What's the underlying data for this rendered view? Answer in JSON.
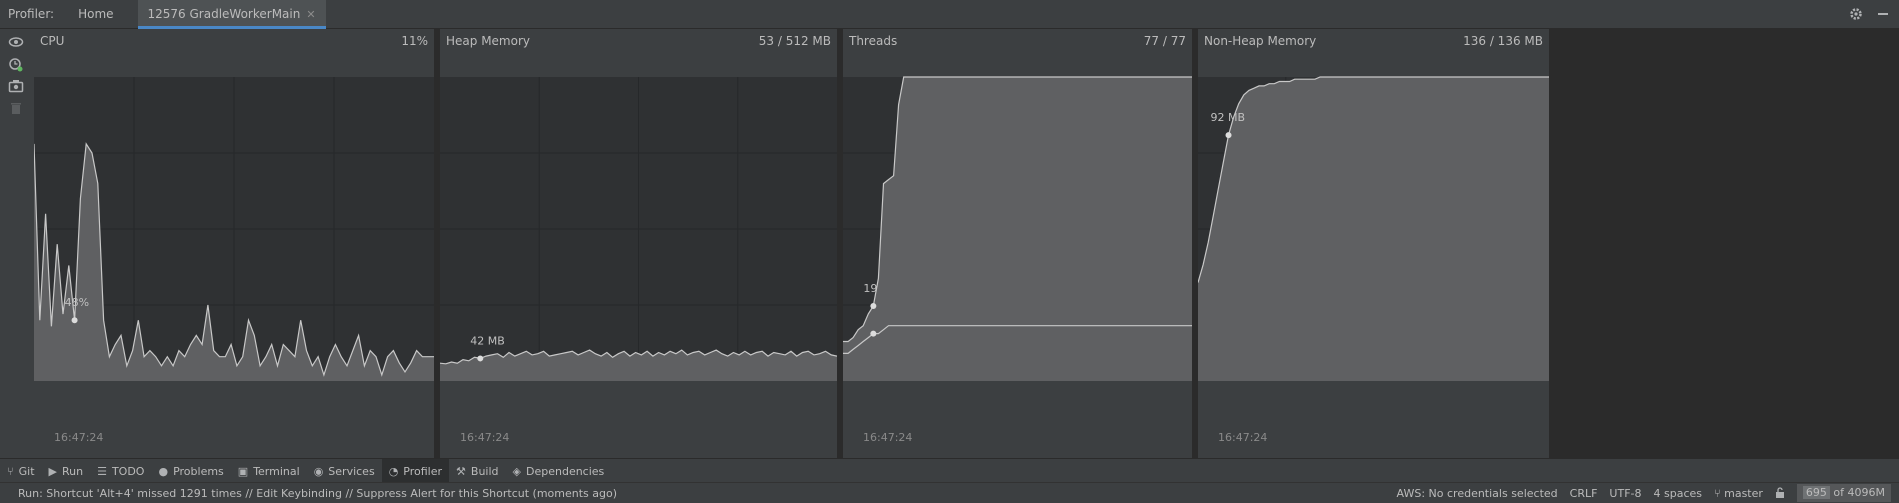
{
  "window": {
    "title": "Profiler:",
    "tabs": [
      {
        "label": "Home"
      },
      {
        "label": "12576 GradleWorkerMain"
      }
    ]
  },
  "panels": [
    {
      "title": "CPU",
      "value": "11%",
      "marker_label": "48%",
      "time": "16:47:24"
    },
    {
      "title": "Heap Memory",
      "value": "53 / 512 MB",
      "marker_label": "42 MB",
      "time": "16:47:24"
    },
    {
      "title": "Threads",
      "value": "77 / 77",
      "marker_label": "19",
      "time": "16:47:24"
    },
    {
      "title": "Non-Heap Memory",
      "value": "136 / 136 MB",
      "marker_label": "92 MB",
      "time": "16:47:24"
    }
  ],
  "bottom_tabs": [
    {
      "label": "Git",
      "icon": "git-branch-icon"
    },
    {
      "label": "Run",
      "icon": "run-icon"
    },
    {
      "label": "TODO",
      "icon": "todo-list-icon"
    },
    {
      "label": "Problems",
      "icon": "problems-icon"
    },
    {
      "label": "Terminal",
      "icon": "terminal-icon"
    },
    {
      "label": "Services",
      "icon": "services-icon"
    },
    {
      "label": "Profiler",
      "icon": "profiler-icon"
    },
    {
      "label": "Build",
      "icon": "build-hammer-icon"
    },
    {
      "label": "Dependencies",
      "icon": "dependencies-icon"
    }
  ],
  "status": {
    "message": "Run: Shortcut 'Alt+4' missed 1291 times // Edit Keybinding // Suppress Alert for this Shortcut (moments ago)",
    "aws": "AWS: No credentials selected",
    "line_sep": "CRLF",
    "encoding": "UTF-8",
    "indent": "4 spaces",
    "branch": "master",
    "memory_used": "695",
    "memory_total": "of 4096M"
  },
  "colors": {
    "accent": "#4a88c7",
    "chart_fill": "#5f6062",
    "chart_line": "#c8c8c8",
    "grid": "#2f3133"
  },
  "chart_data": [
    {
      "type": "area",
      "title": "CPU",
      "ylim": [
        0,
        100
      ],
      "y": [
        78,
        20,
        55,
        18,
        45,
        22,
        38,
        20,
        60,
        78,
        75,
        65,
        20,
        8,
        12,
        15,
        5,
        10,
        20,
        8,
        10,
        8,
        5,
        8,
        5,
        10,
        8,
        12,
        15,
        12,
        25,
        10,
        8,
        8,
        12,
        5,
        8,
        20,
        15,
        5,
        8,
        12,
        5,
        12,
        10,
        8,
        20,
        10,
        5,
        8,
        2,
        8,
        12,
        8,
        5,
        10,
        15,
        5,
        10,
        8,
        2,
        8,
        10,
        6,
        3,
        6,
        10,
        8,
        8,
        8
      ]
    },
    {
      "type": "area",
      "title": "Heap Memory",
      "ylim": [
        0,
        512
      ],
      "y": [
        30,
        29,
        32,
        30,
        36,
        34,
        40,
        38,
        42,
        44,
        46,
        40,
        48,
        42,
        46,
        50,
        44,
        46,
        50,
        42,
        44,
        46,
        48,
        50,
        44,
        48,
        52,
        46,
        42,
        48,
        40,
        46,
        50,
        42,
        48,
        44,
        50,
        42,
        48,
        44,
        50,
        46,
        52,
        44,
        48,
        50,
        44,
        48,
        52,
        46,
        42,
        48,
        44,
        50,
        44,
        48,
        50,
        42,
        48,
        46,
        44,
        50,
        42,
        48,
        50,
        44,
        46,
        50,
        44,
        42
      ]
    },
    {
      "type": "area",
      "title": "Threads",
      "ylim": [
        0,
        77
      ],
      "series": [
        {
          "values": [
            10,
            10,
            11,
            13,
            14,
            17,
            19,
            26,
            50,
            51,
            52,
            70,
            77,
            77,
            77,
            77,
            77,
            77,
            77,
            77,
            77,
            77,
            77,
            77,
            77,
            77,
            77,
            77,
            77,
            77,
            77,
            77,
            77,
            77,
            77,
            77,
            77,
            77,
            77,
            77,
            77,
            77,
            77,
            77,
            77,
            77,
            77,
            77,
            77,
            77,
            77,
            77,
            77,
            77,
            77,
            77,
            77,
            77,
            77,
            77,
            77,
            77,
            77,
            77,
            77,
            77,
            77,
            77,
            77,
            77
          ]
        },
        {
          "values": [
            7,
            7,
            8,
            9,
            10,
            11,
            12,
            12,
            13,
            14,
            14,
            14,
            14,
            14,
            14,
            14,
            14,
            14,
            14,
            14,
            14,
            14,
            14,
            14,
            14,
            14,
            14,
            14,
            14,
            14,
            14,
            14,
            14,
            14,
            14,
            14,
            14,
            14,
            14,
            14,
            14,
            14,
            14,
            14,
            14,
            14,
            14,
            14,
            14,
            14,
            14,
            14,
            14,
            14,
            14,
            14,
            14,
            14,
            14,
            14,
            14,
            14,
            14,
            14,
            14,
            14,
            14,
            14,
            14,
            14
          ]
        }
      ]
    },
    {
      "type": "area",
      "title": "Non-Heap Memory",
      "ylim": [
        0,
        136
      ],
      "y": [
        44,
        52,
        62,
        74,
        86,
        98,
        110,
        118,
        124,
        128,
        130,
        131,
        132,
        132,
        133,
        133,
        134,
        134,
        134,
        135,
        135,
        135,
        135,
        135,
        136,
        136,
        136,
        136,
        136,
        136,
        136,
        136,
        136,
        136,
        136,
        136,
        136,
        136,
        136,
        136,
        136,
        136,
        136,
        136,
        136,
        136,
        136,
        136,
        136,
        136,
        136,
        136,
        136,
        136,
        136,
        136,
        136,
        136,
        136,
        136,
        136,
        136,
        136,
        136,
        136,
        136,
        136,
        136,
        136,
        136
      ]
    }
  ]
}
